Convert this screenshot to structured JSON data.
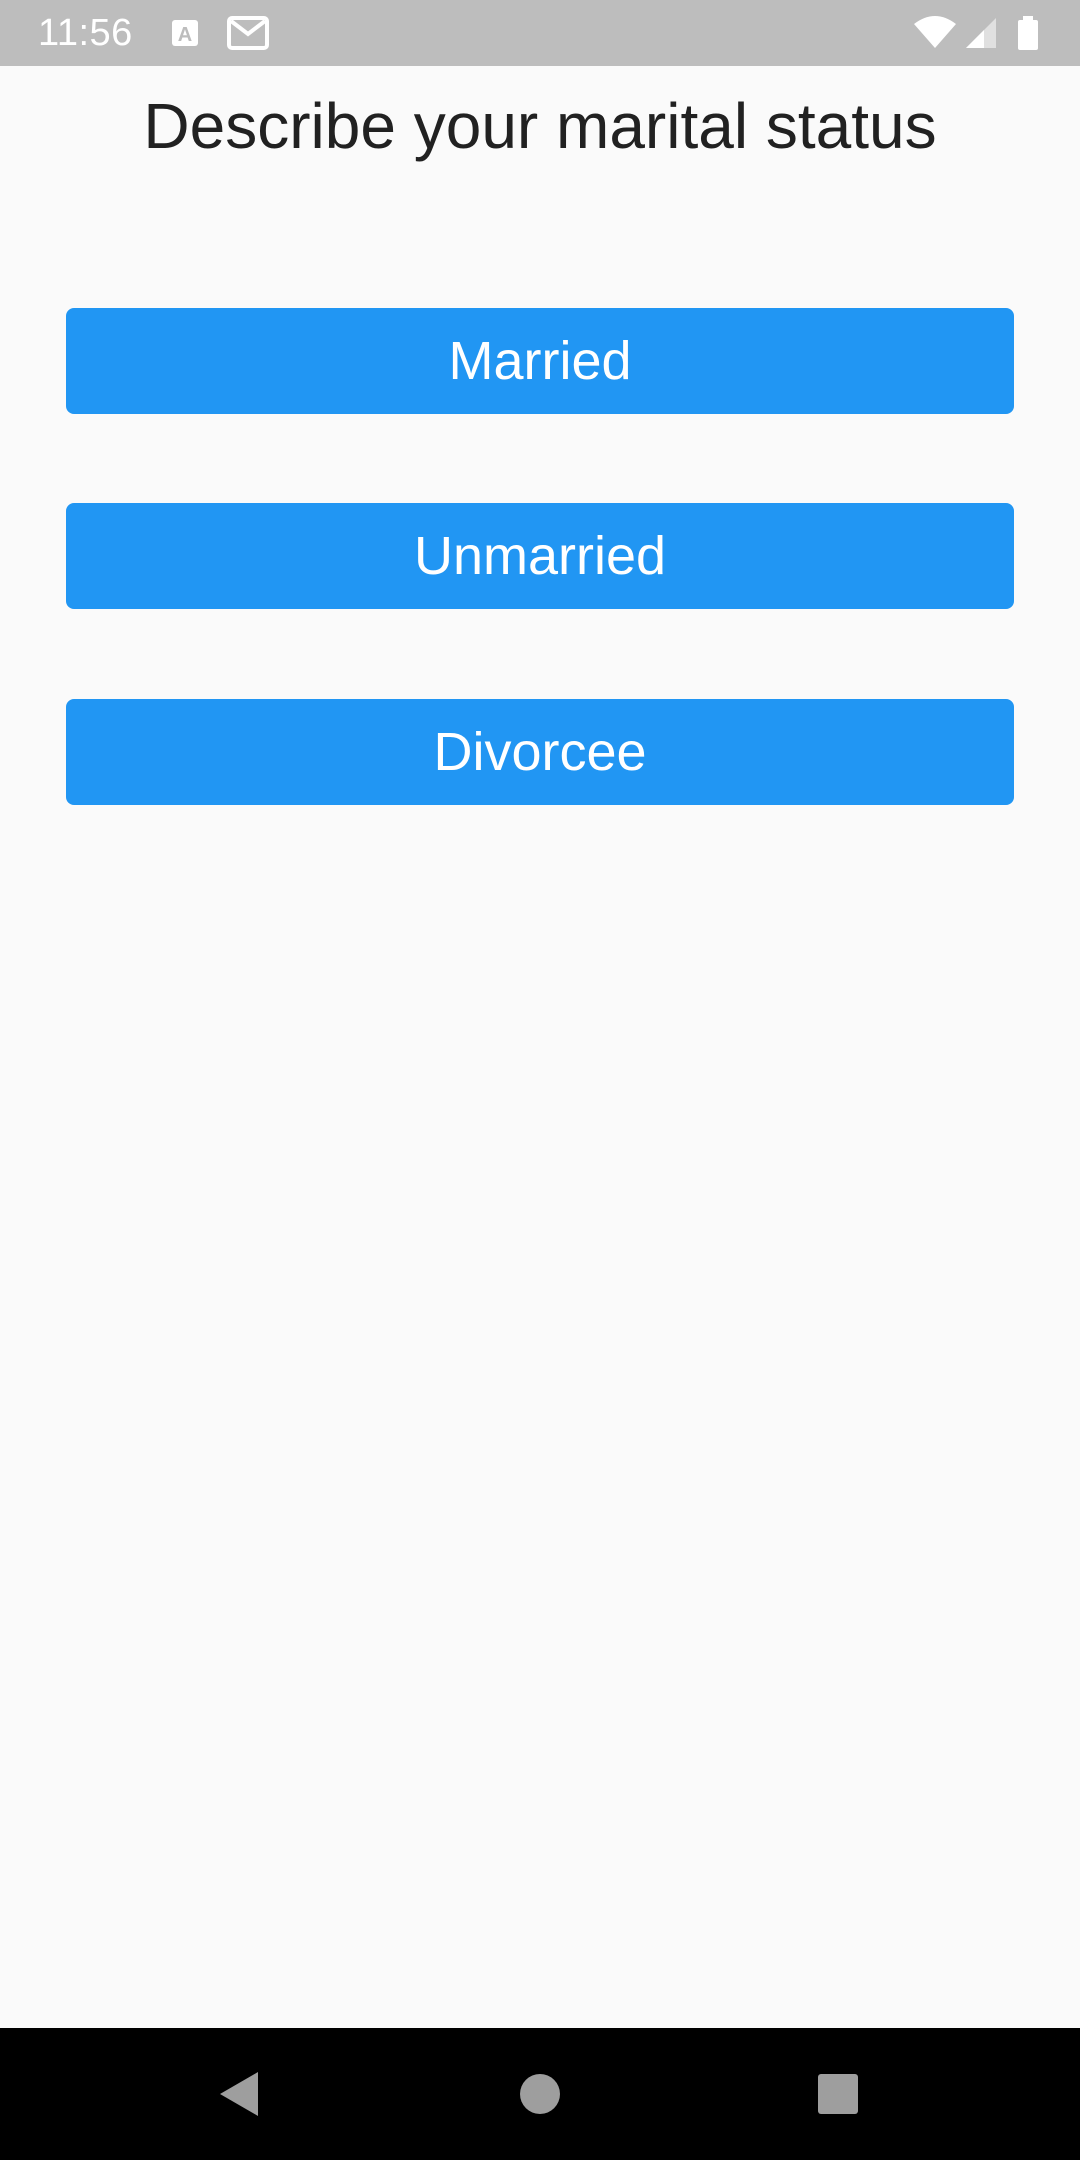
{
  "status_bar": {
    "time": "11:56",
    "icons": [
      "a-notification-icon",
      "gmail-icon",
      "wifi-icon",
      "cell-signal-icon",
      "battery-icon"
    ]
  },
  "main": {
    "title": "Describe your marital status",
    "options": [
      {
        "label": "Married"
      },
      {
        "label": "Unmarried"
      },
      {
        "label": "Divorcee"
      }
    ]
  },
  "nav_bar": {
    "buttons": [
      "back-icon",
      "home-icon",
      "recents-icon"
    ]
  },
  "colors": {
    "status_bar_bg": "#bdbdbd",
    "background": "#fafafa",
    "button_bg": "#2196f3",
    "button_text": "#ffffff",
    "title_text": "#212121",
    "nav_bar_bg": "#000000"
  }
}
